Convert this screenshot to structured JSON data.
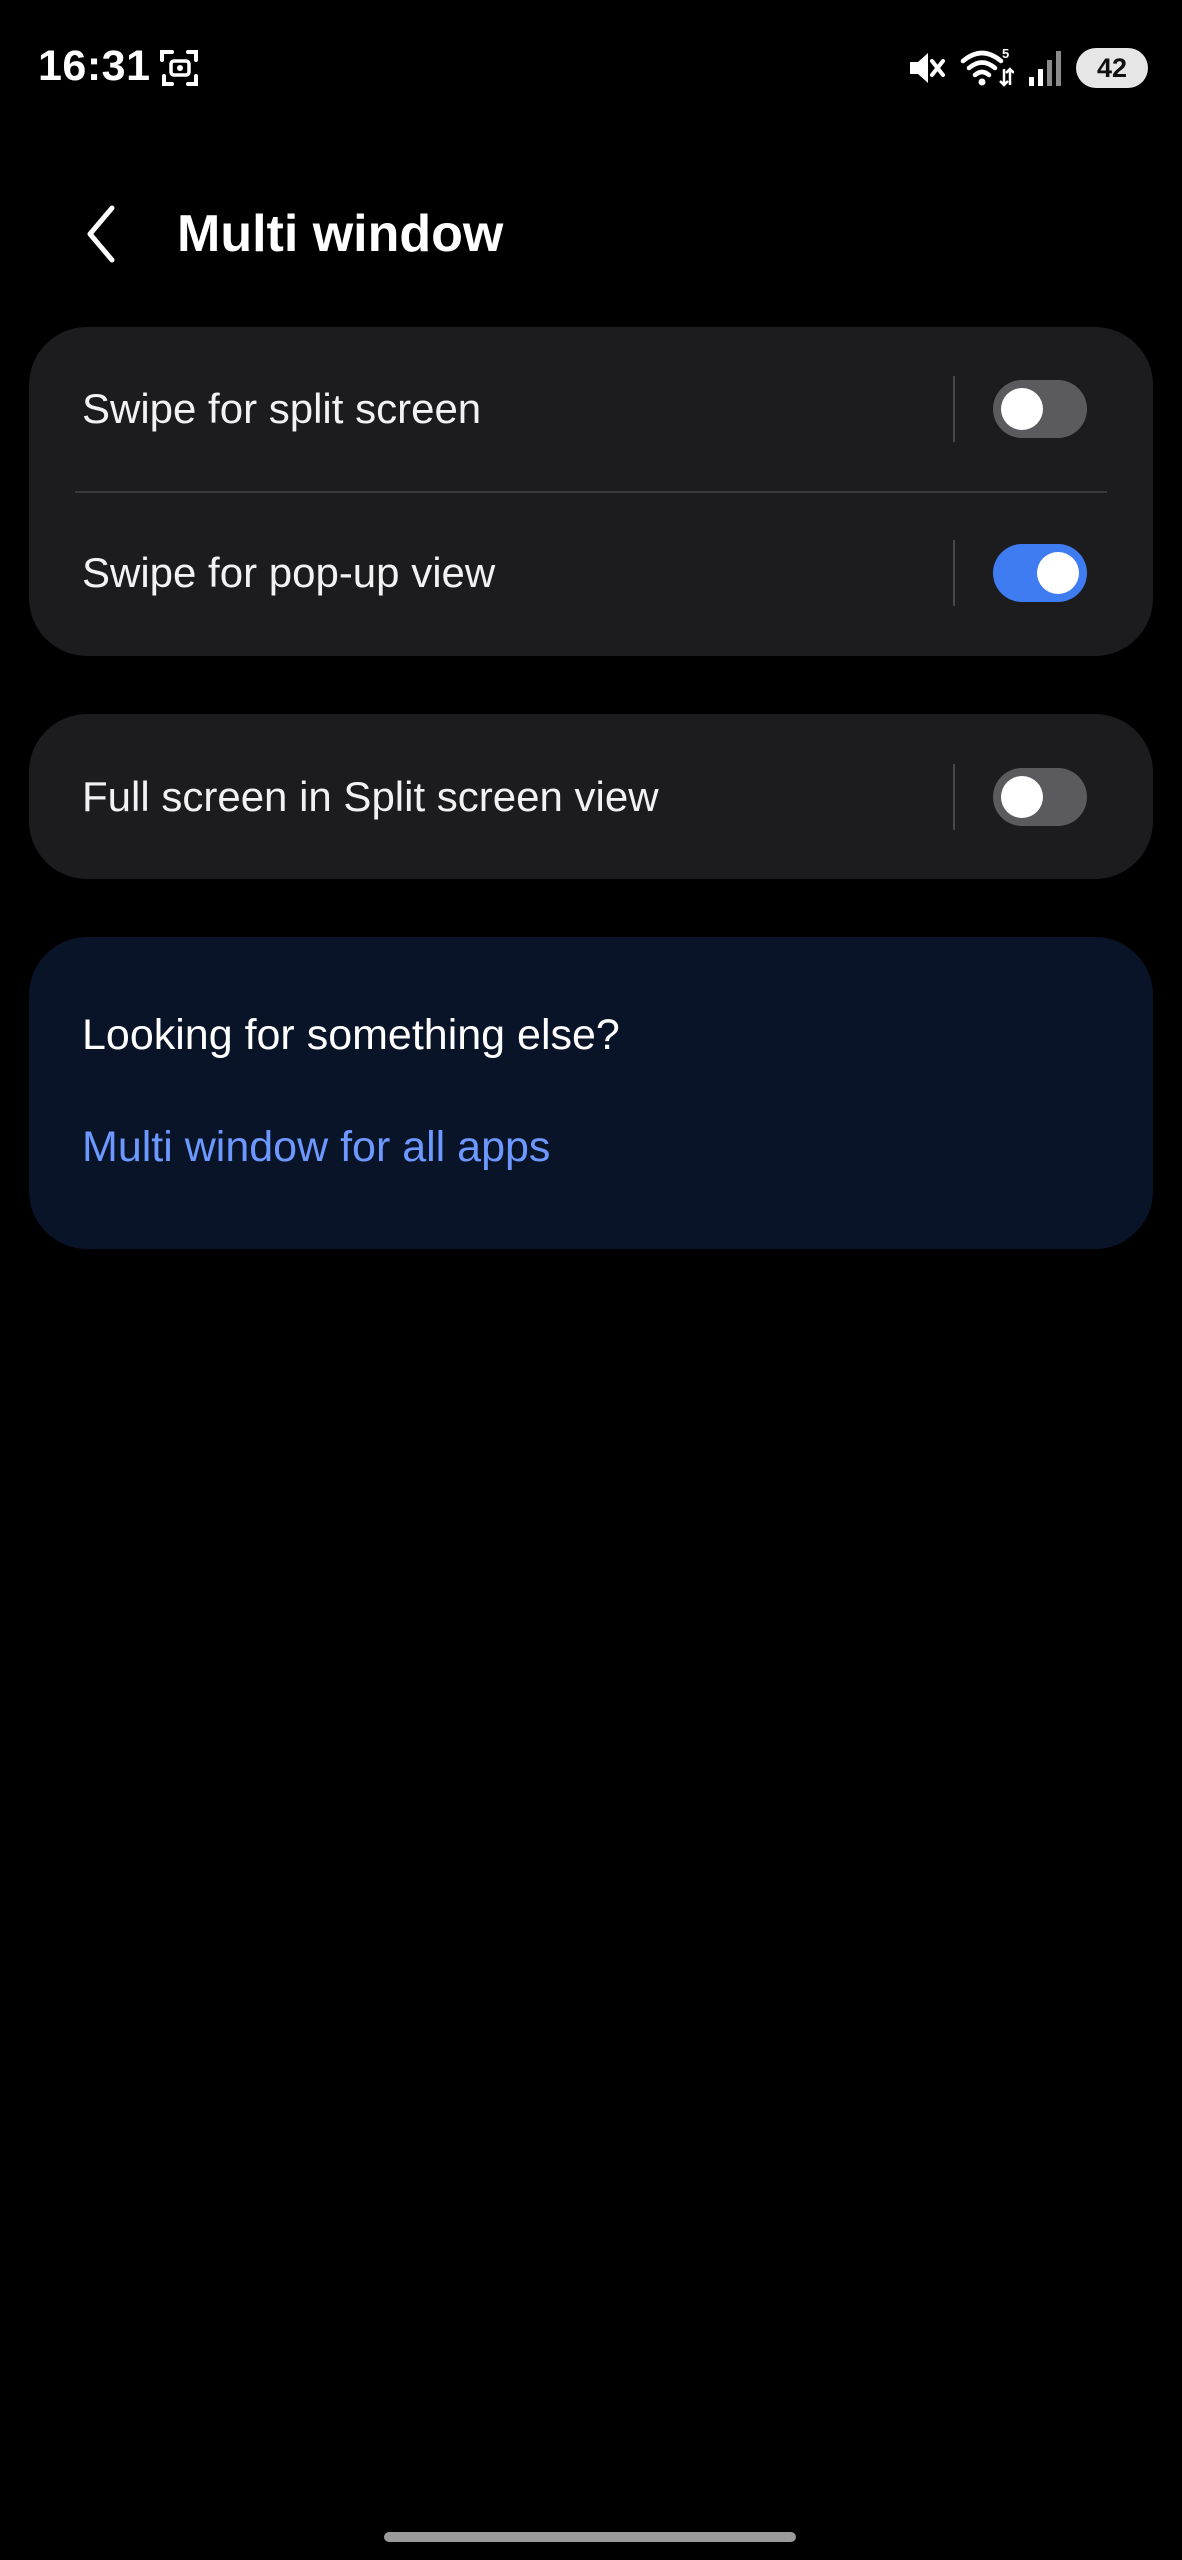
{
  "status_bar": {
    "time": "16:31",
    "battery_level": "42",
    "icons": [
      "screen-capture-icon",
      "mute-icon",
      "wifi-icon",
      "signal-icon",
      "battery-icon"
    ],
    "wifi_badge": "5"
  },
  "app_bar": {
    "title": "Multi window",
    "back_icon": "chevron-left-icon"
  },
  "settings": [
    {
      "label": "Swipe for split screen",
      "enabled": false
    },
    {
      "label": "Swipe for pop-up view",
      "enabled": true
    },
    {
      "label": "Full screen in Split screen view",
      "enabled": false
    }
  ],
  "help_card": {
    "heading": "Looking for something else?",
    "link": "Multi window for all apps"
  },
  "colors": {
    "background": "#000000",
    "card": "#1c1c1e",
    "help_card": "#0a1428",
    "toggle_on": "#3f7cf2",
    "toggle_off": "#5b5b5f",
    "link": "#6c98ff"
  }
}
